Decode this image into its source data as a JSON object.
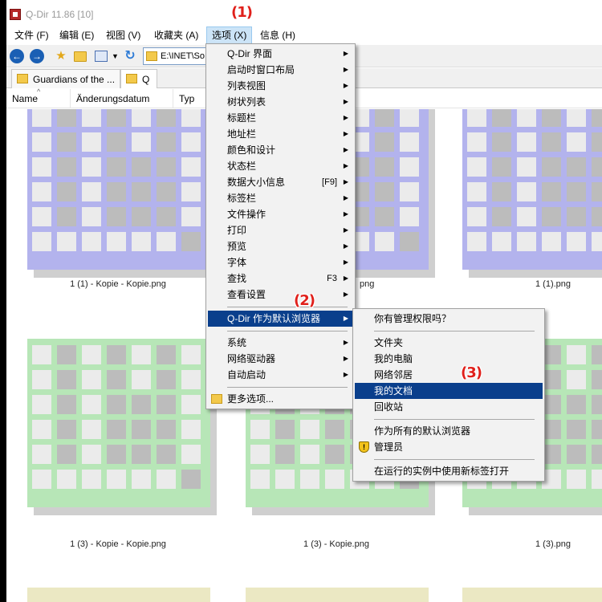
{
  "window": {
    "title": "Q-Dir 11.86 [10]"
  },
  "menubar": {
    "items": [
      "文件 (F)",
      "编辑 (E)",
      "视图 (V)",
      "收藏夹 (A)",
      "选项 (X)",
      "信息 (H)"
    ],
    "active_index": 4
  },
  "toolbar": {
    "icons": [
      "back-icon",
      "forward-icon",
      "up-star-icon",
      "new-folder-icon",
      "view-mode-icon",
      "dropdown-icon",
      "refresh-icon"
    ],
    "address_path": "E:\\INET\\So"
  },
  "tabs": [
    {
      "label": "Guardians of the ..."
    },
    {
      "label": "Q"
    }
  ],
  "columns": [
    "Name",
    "Änderungsdatum",
    "Typ"
  ],
  "files": [
    {
      "caption": "1 (1) - Kopie - Kopie.png",
      "color": "purple"
    },
    {
      "caption": "png",
      "color": "purple"
    },
    {
      "caption": "1 (1).png",
      "color": "purple"
    },
    {
      "caption": "1 (3) - Kopie - Kopie.png",
      "color": "green"
    },
    {
      "caption": "1 (3) - Kopie.png",
      "color": "green"
    },
    {
      "caption": "1 (3).png",
      "color": "green"
    }
  ],
  "colors": {
    "purple_light": "#b3b3ed",
    "purple_cell": "#ebebeb",
    "purple_dark": "#bcbcbc",
    "green_light": "#b7e6b7",
    "green_cell": "#ebebeb",
    "green_dark": "#bcbcbc",
    "yellow_light": "#ebe8c3",
    "highlight": "#0a3f8c",
    "annotation": "#e0201b"
  },
  "options_menu": {
    "items": [
      {
        "label": "Q-Dir 界面",
        "submenu": true
      },
      {
        "label": "启动时窗口布局",
        "submenu": true
      },
      {
        "label": "列表视图",
        "submenu": true
      },
      {
        "label": "树状列表",
        "submenu": true
      },
      {
        "label": "标题栏",
        "submenu": true
      },
      {
        "label": "地址栏",
        "submenu": true
      },
      {
        "label": "颜色和设计",
        "submenu": true
      },
      {
        "label": "状态栏",
        "submenu": true
      },
      {
        "label": "数据大小信息",
        "shortcut": "[F9]",
        "submenu": true
      },
      {
        "label": "标签栏",
        "submenu": true
      },
      {
        "label": "文件操作",
        "submenu": true
      },
      {
        "label": "打印",
        "submenu": true
      },
      {
        "label": "预览",
        "submenu": true
      },
      {
        "label": "字体",
        "submenu": true
      },
      {
        "label": "查找",
        "shortcut": "F3",
        "submenu": true
      },
      {
        "label": "查看设置",
        "submenu": true
      },
      {
        "label": "Q-Dir 作为默认浏览器",
        "submenu": true,
        "highlighted": true
      },
      {
        "label": "系统",
        "submenu": true
      },
      {
        "label": "网络驱动器",
        "submenu": true
      },
      {
        "label": "自动启动",
        "submenu": true
      },
      {
        "label": "更多选项...",
        "submenu": false
      }
    ]
  },
  "browser_submenu": {
    "items": [
      {
        "label": "你有管理权限吗？"
      },
      {
        "label": "文件夹"
      },
      {
        "label": "我的电脑"
      },
      {
        "label": "网络邻居"
      },
      {
        "label": "我的文档",
        "highlighted": true
      },
      {
        "label": "回收站"
      },
      {
        "label": "作为所有的默认浏览器"
      },
      {
        "label": "管理员"
      },
      {
        "label": "在运行的实例中使用新标签打开"
      }
    ]
  },
  "annotations": [
    "(1)",
    "(2)",
    "(3)"
  ]
}
